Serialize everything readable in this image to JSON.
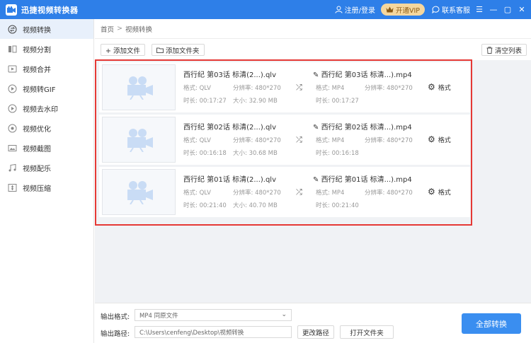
{
  "app": {
    "title": "迅捷视频转换器"
  },
  "titlebar": {
    "login": "注册/登录",
    "vip": "开通VIP",
    "support": "联系客服"
  },
  "sidebar": {
    "items": [
      {
        "label": "视频转换",
        "icon": "convert-icon"
      },
      {
        "label": "视频分割",
        "icon": "split-icon"
      },
      {
        "label": "视频合并",
        "icon": "merge-icon"
      },
      {
        "label": "视频转GIF",
        "icon": "gif-icon"
      },
      {
        "label": "视频去水印",
        "icon": "watermark-icon"
      },
      {
        "label": "视频优化",
        "icon": "optimize-icon"
      },
      {
        "label": "视频截图",
        "icon": "screenshot-icon"
      },
      {
        "label": "视频配乐",
        "icon": "music-icon"
      },
      {
        "label": "视频压缩",
        "icon": "compress-icon"
      }
    ]
  },
  "breadcrumb": {
    "home": "首页",
    "sep": ">",
    "current": "视频转换"
  },
  "toolbar": {
    "add_file": "+ 添加文件",
    "add_folder": "添加文件夹",
    "clear": "清空列表"
  },
  "labels": {
    "format": "格式:",
    "resolution": "分辨率:",
    "duration": "时长:",
    "size": "大小:",
    "format_btn": "格式"
  },
  "files": [
    {
      "src_name": "西行纪 第03话 标清(2...).qlv",
      "src_format": "QLV",
      "src_res": "480*270",
      "src_duration": "00:17:27",
      "src_size": "32.90 MB",
      "dst_name": "西行纪 第03话 标清...).mp4",
      "dst_format": "MP4",
      "dst_res": "480*270",
      "dst_duration": "00:17:27"
    },
    {
      "src_name": "西行纪 第02话 标清(2...).qlv",
      "src_format": "QLV",
      "src_res": "480*270",
      "src_duration": "00:16:18",
      "src_size": "30.68 MB",
      "dst_name": "西行纪 第02话 标清...).mp4",
      "dst_format": "MP4",
      "dst_res": "480*270",
      "dst_duration": "00:16:18"
    },
    {
      "src_name": "西行纪 第01话 标清(2...).qlv",
      "src_format": "QLV",
      "src_res": "480*270",
      "src_duration": "00:21:40",
      "src_size": "40.70 MB",
      "dst_name": "西行纪 第01话 标清...).mp4",
      "dst_format": "MP4",
      "dst_res": "480*270",
      "dst_duration": "00:21:40"
    }
  ],
  "output": {
    "format_label": "输出格式:",
    "format_value": "MP4  同原文件",
    "path_label": "输出路径:",
    "path_value": "C:\\Users\\cenfeng\\Desktop\\视频转换",
    "change_path": "更改路径",
    "open_folder": "打开文件夹",
    "convert_all": "全部转换"
  },
  "colors": {
    "titlebar": "#2e7fe8",
    "accent": "#3a8ef0",
    "highlight": "#e53935",
    "vip": "#f5d79e"
  }
}
